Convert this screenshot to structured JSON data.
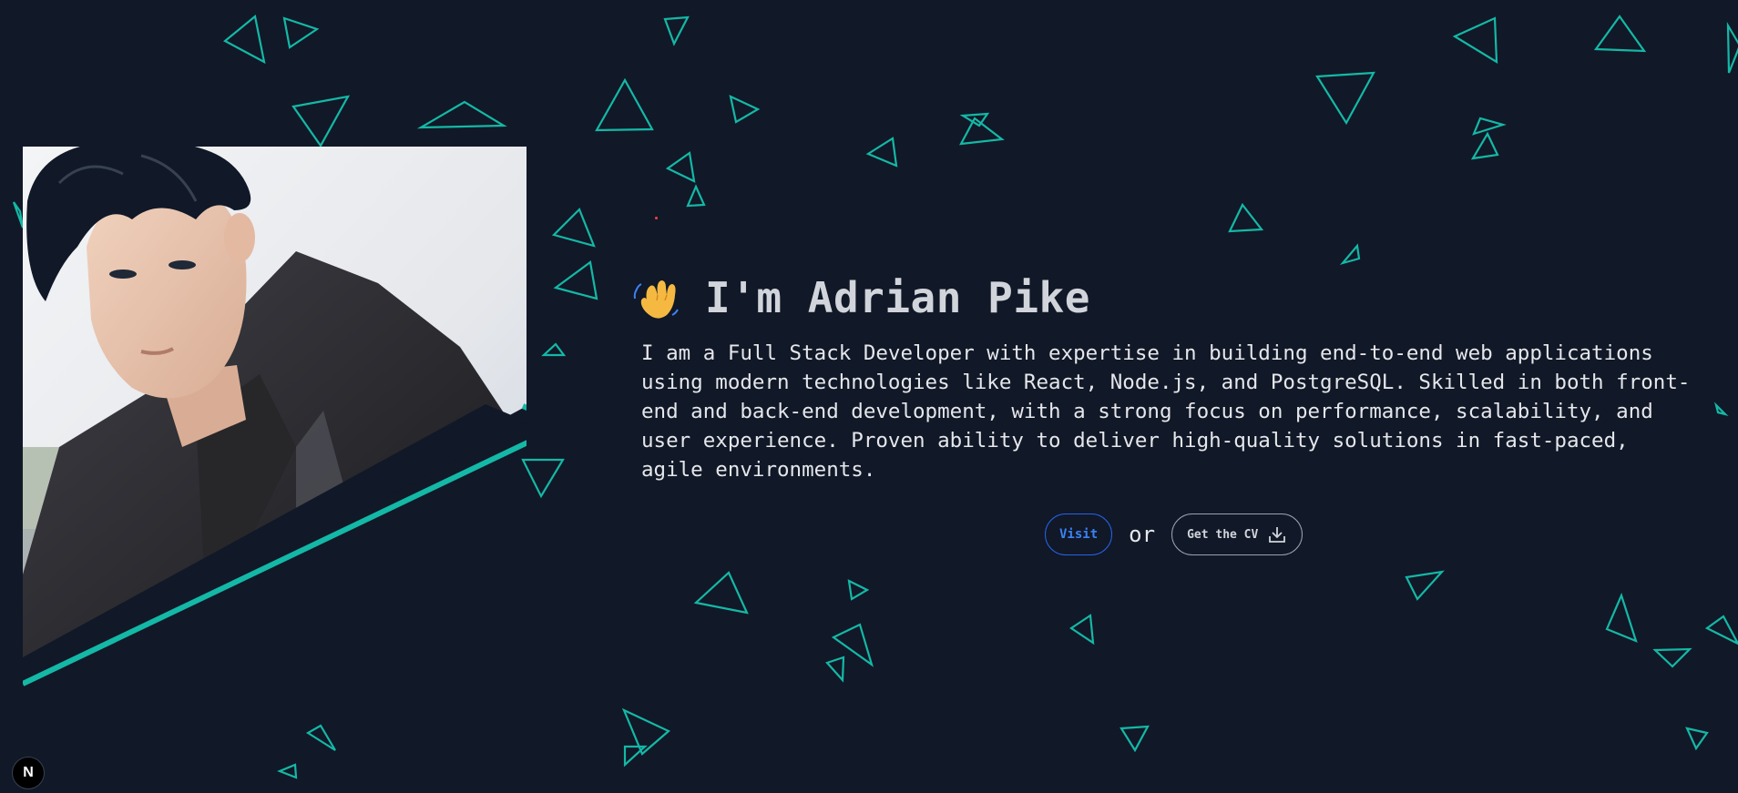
{
  "hero": {
    "greeting_icon": "waving-hand-icon",
    "title": "I'm Adrian Pike",
    "description": "I am a Full Stack Developer with expertise in building end-to-end web applications using modern technologies like React, Node.js, and PostgreSQL. Skilled in both front-end and back-end development, with a strong focus on performance, scalability, and user experience. Proven ability to deliver high-quality solutions in fast-paced, agile environments."
  },
  "actions": {
    "visit_label": "Visit",
    "or_text": "or",
    "cv_label": "Get the CV",
    "cv_icon": "download-icon"
  },
  "badge": {
    "label": "N",
    "icon": "nextjs-logo-icon"
  },
  "portrait": {
    "icon": "profile-photo"
  },
  "colors": {
    "background": "#111827",
    "accent": "#14b8a6",
    "link": "#3b82f6",
    "text": "#e5e7eb"
  }
}
